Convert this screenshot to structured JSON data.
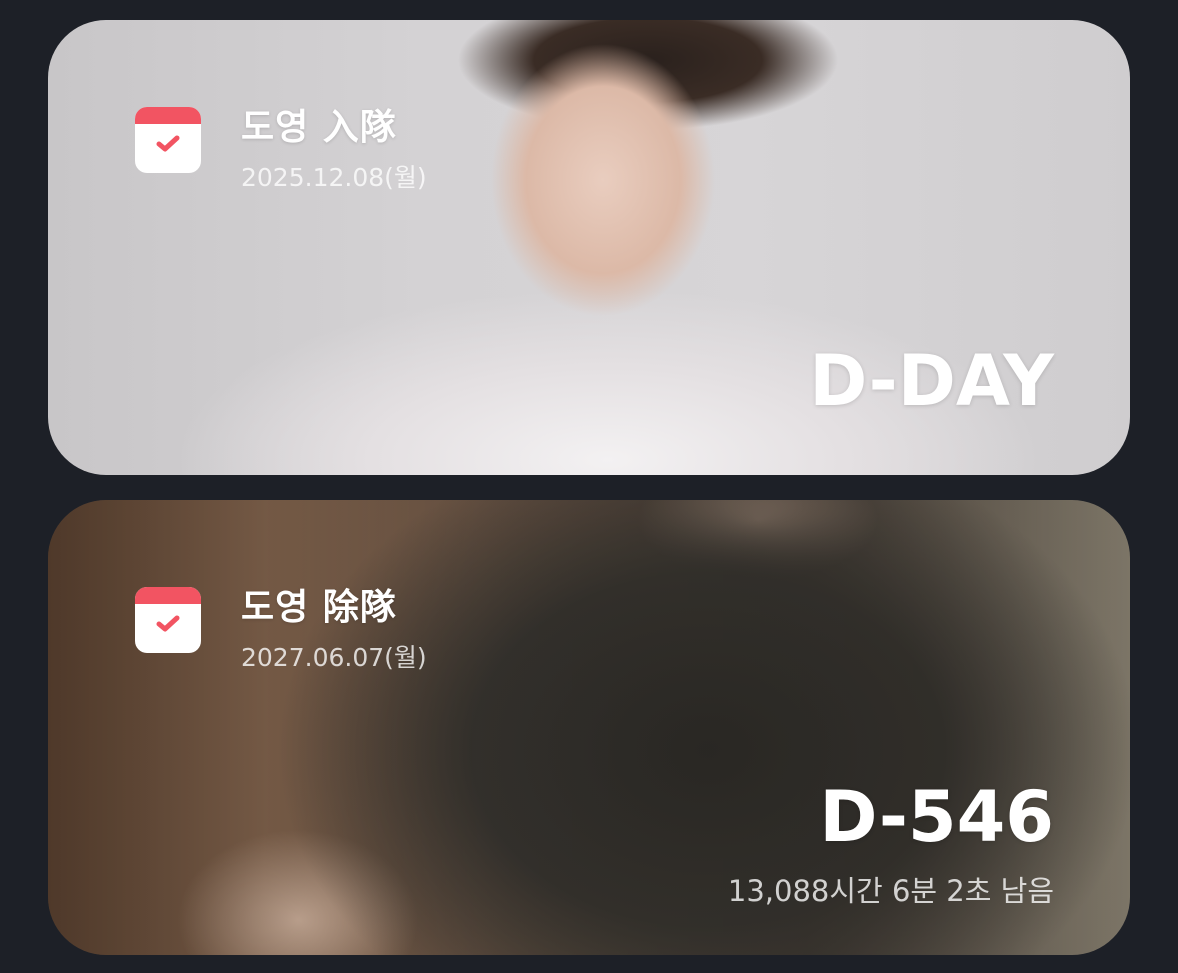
{
  "widgets": [
    {
      "icon": "calendar-check-icon",
      "title": "도영 入隊",
      "date": "2025.12.08(월)",
      "dday": "D-DAY"
    },
    {
      "icon": "calendar-check-icon",
      "title": "도영 除隊",
      "date": "2027.06.07(월)",
      "dday": "D-546",
      "remaining": "13,088시간 6분 2초 남음"
    }
  ],
  "colors": {
    "background": "#1d2027",
    "calendar_accent": "#f25462"
  }
}
